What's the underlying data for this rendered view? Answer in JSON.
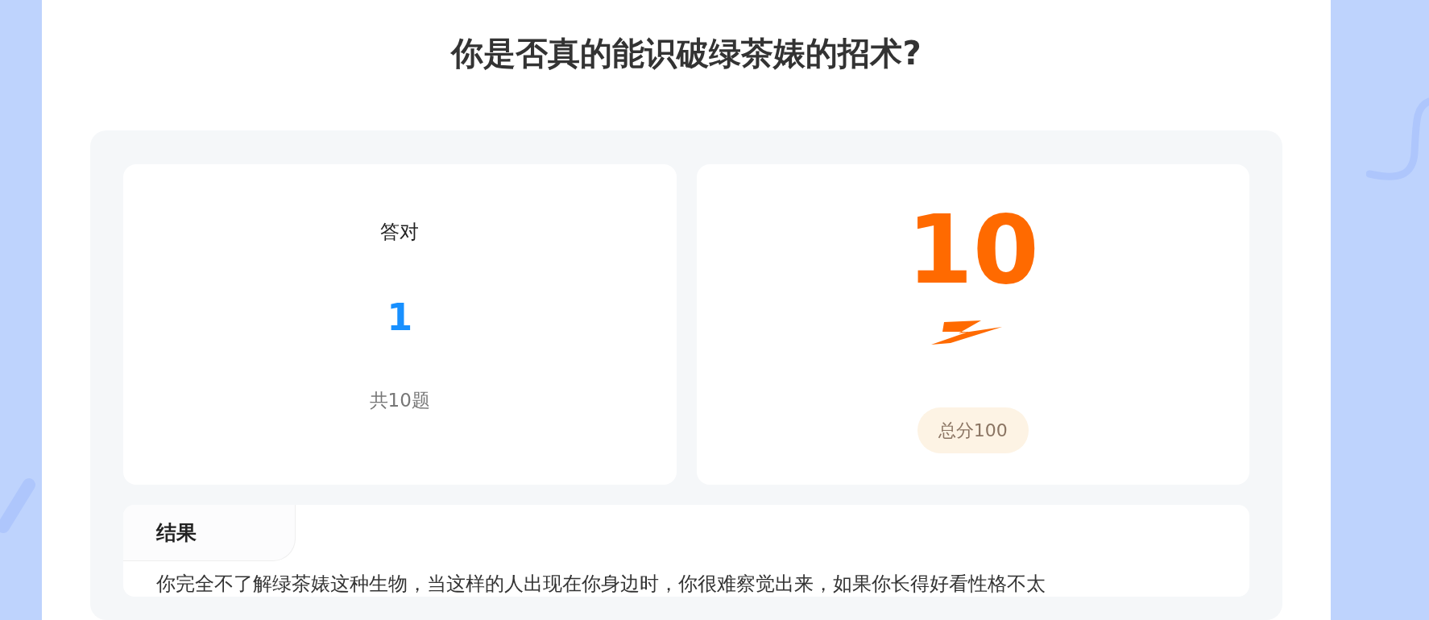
{
  "title": "你是否真的能识破绿茶婊的招术?",
  "correct": {
    "label": "答对",
    "count": "1",
    "total": "共10题"
  },
  "score": {
    "value": "10",
    "total": "总分100"
  },
  "result": {
    "tab": "结果",
    "text": "你完全不了解绿茶婊这种生物，当这样的人出现在你身边时，你很难察觉出来，如果你长得好看性格不太"
  }
}
